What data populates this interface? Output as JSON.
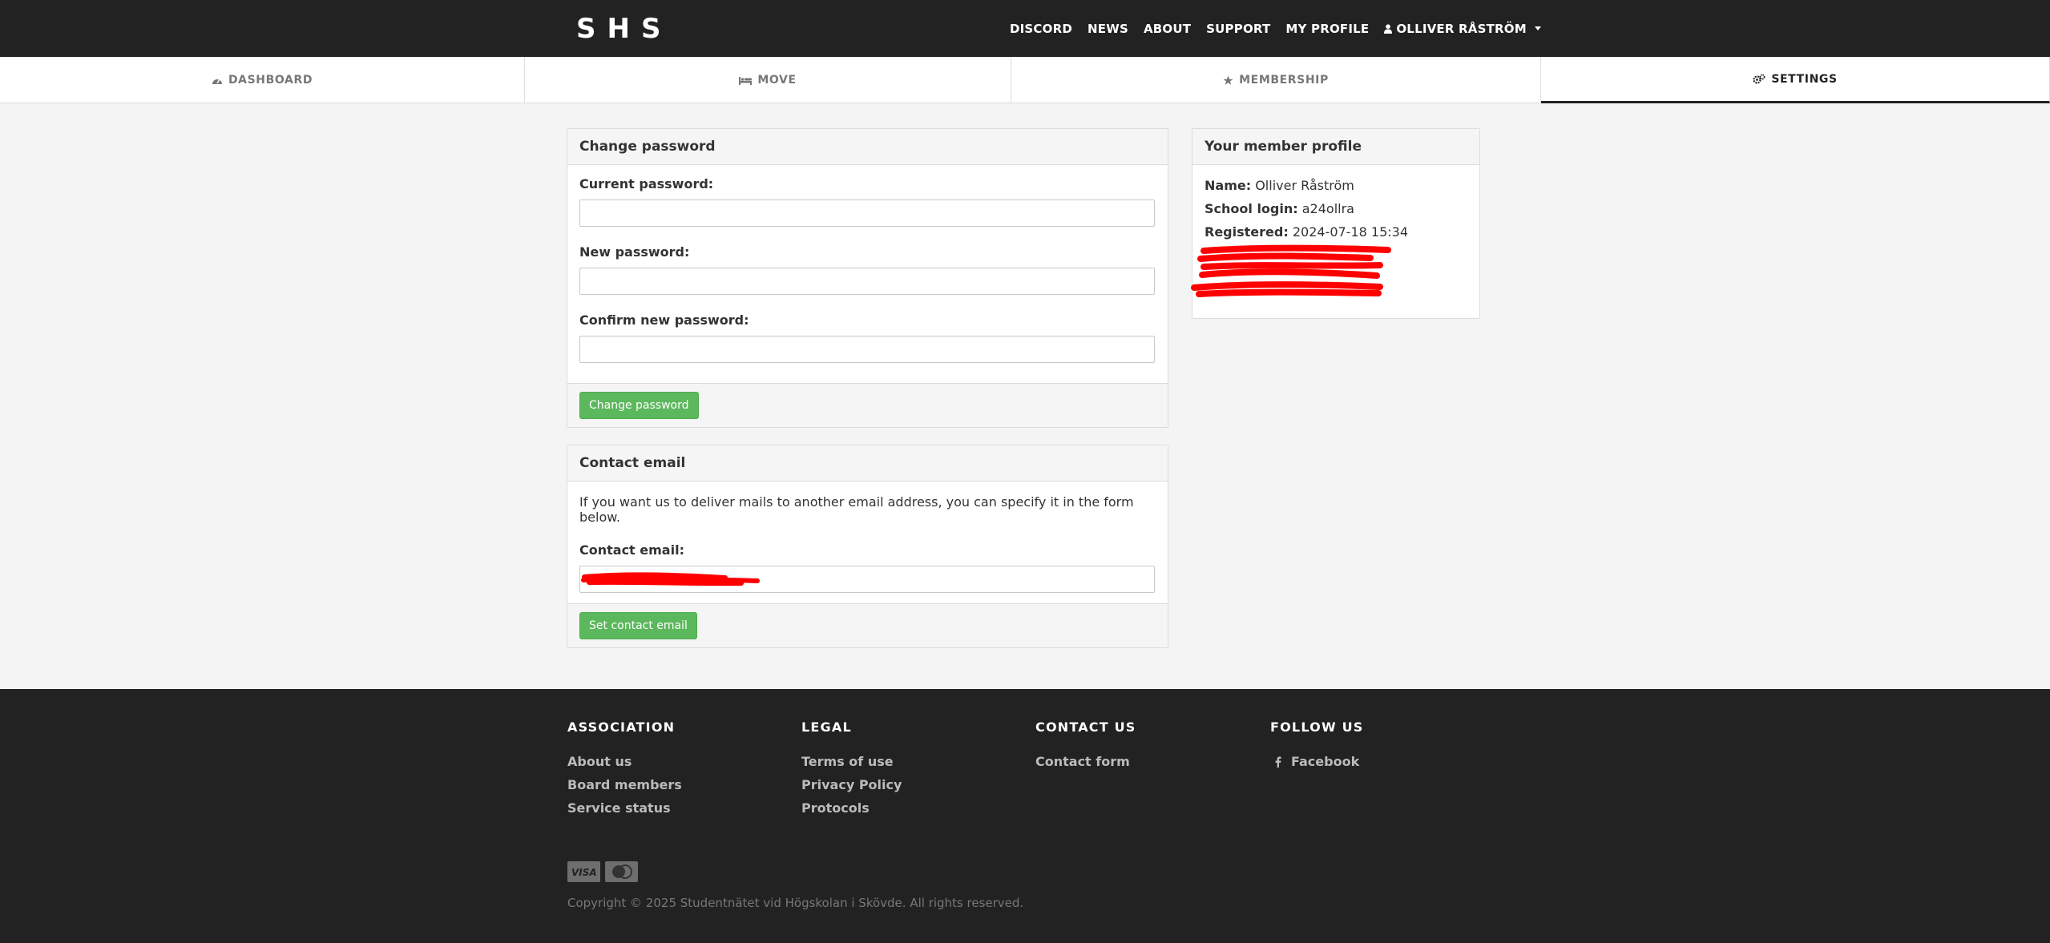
{
  "navbar": {
    "logo_text": "SHS",
    "links": [
      "DISCORD",
      "NEWS",
      "ABOUT",
      "SUPPORT",
      "MY PROFILE"
    ],
    "user_menu": "OLLIVER RÅSTRÖM"
  },
  "tabs": [
    {
      "label": "DASHBOARD",
      "icon": "dashboard-icon"
    },
    {
      "label": "MOVE",
      "icon": "bed-icon"
    },
    {
      "label": "MEMBERSHIP",
      "icon": "star-icon"
    },
    {
      "label": "SETTINGS",
      "icon": "cogs-icon",
      "active": true
    }
  ],
  "change_password": {
    "title": "Change password",
    "current_label": "Current password:",
    "new_label": "New password:",
    "confirm_label": "Confirm new password:",
    "button": "Change password"
  },
  "contact_email": {
    "title": "Contact email",
    "help": "If you want us to deliver mails to another email address, you can specify it in the form below.",
    "label": "Contact email:",
    "button": "Set contact email"
  },
  "profile": {
    "title": "Your member profile",
    "name_label": "Name:",
    "name": "Olliver Råström",
    "login_label": "School login:",
    "login": "a24ollra",
    "registered_label": "Registered:",
    "registered": "2024-07-18 15:34"
  },
  "footer": {
    "association": {
      "title": "ASSOCIATION",
      "links": [
        "About us",
        "Board members",
        "Service status"
      ]
    },
    "legal": {
      "title": "LEGAL",
      "links": [
        "Terms of use",
        "Privacy Policy",
        "Protocols"
      ]
    },
    "contact": {
      "title": "CONTACT US",
      "links": [
        "Contact form"
      ]
    },
    "follow": {
      "title": "FOLLOW US",
      "links": [
        "Facebook"
      ]
    },
    "cards": [
      "VISA",
      "Mastercard"
    ],
    "copyright": "Copyright © 2025 Studentnätet vid Högskolan i Skövde. All rights reserved."
  },
  "colors": {
    "navbar_bg": "#222222",
    "button_green": "#5cb85c",
    "redaction": "#ff0000"
  }
}
